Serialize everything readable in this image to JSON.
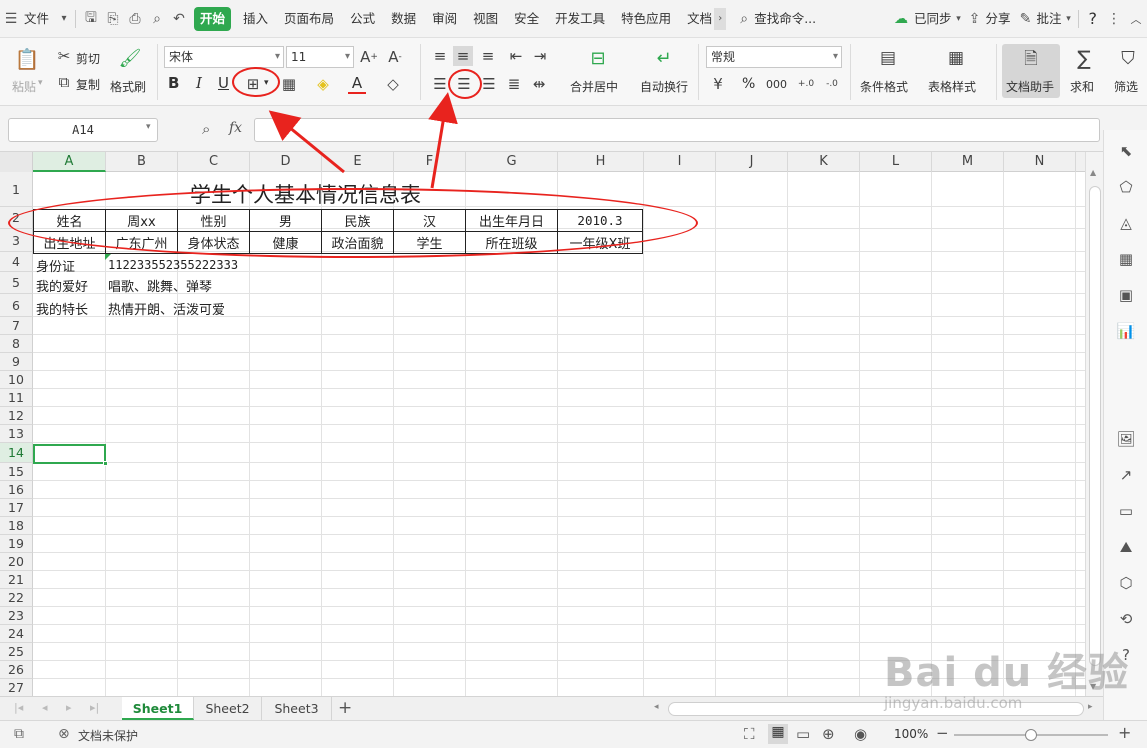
{
  "menubar": {
    "file_label": "文件",
    "tabs": [
      "开始",
      "插入",
      "页面布局",
      "公式",
      "数据",
      "审阅",
      "视图",
      "安全",
      "开发工具",
      "特色应用",
      "文档"
    ],
    "active_tab": "开始",
    "search_label": "查找命令...",
    "sync_label": "已同步",
    "share_label": "分享",
    "comment_label": "批注",
    "help_label": "?"
  },
  "ribbon": {
    "paste_label": "粘贴",
    "cut_label": "剪切",
    "copy_label": "复制",
    "format_painter_label": "格式刷",
    "font_name": "宋体",
    "font_size": "11",
    "bold_label": "B",
    "italic_label": "I",
    "underline_label": "U",
    "merge_center_label": "合并居中",
    "wrap_text_label": "自动换行",
    "number_format": "常规",
    "percent_label": "%",
    "thousands_label": "000",
    "cond_format_label": "条件格式",
    "table_style_label": "表格样式",
    "doc_assistant_label": "文档助手",
    "sum_label": "求和",
    "filter_label": "筛选"
  },
  "formula_bar": {
    "name_box": "A14",
    "fx_label": "fx",
    "value": ""
  },
  "grid": {
    "columns": [
      "A",
      "B",
      "C",
      "D",
      "E",
      "F",
      "G",
      "H",
      "I",
      "J",
      "K",
      "L",
      "M",
      "N"
    ],
    "rows": [
      "1",
      "2",
      "3",
      "4",
      "5",
      "6",
      "7",
      "8",
      "9",
      "10",
      "11",
      "12",
      "13",
      "14",
      "15",
      "16",
      "17",
      "18",
      "19",
      "20",
      "21",
      "22",
      "23",
      "24",
      "25",
      "26",
      "27"
    ],
    "selected_column": "A",
    "selected_row": "14",
    "title": "学生个人基本情况信息表",
    "row2": [
      "姓名",
      "周xx",
      "性别",
      "男",
      "民族",
      "汉",
      "出生年月日",
      "2010.3"
    ],
    "row3": [
      "出生地址",
      "广东广州",
      "身体状态",
      "健康",
      "政治面貌",
      "学生",
      "所在班级",
      "一年级X班"
    ],
    "row4": [
      "身份证",
      "112233552355222333"
    ],
    "row5": [
      "我的爱好",
      "唱歌、跳舞、弹琴"
    ],
    "row6": [
      "我的特长",
      "热情开朗、活泼可爱"
    ]
  },
  "sheets": {
    "tabs": [
      "Sheet1",
      "Sheet2",
      "Sheet3"
    ],
    "active": "Sheet1",
    "add_label": "+"
  },
  "status": {
    "protect_label": "文档未保护",
    "zoom": "100%",
    "zoom_fraction": 0.5
  },
  "watermark": {
    "logo": "Bai du 经验",
    "url": "jingyan.baidu.com"
  },
  "colors": {
    "accent": "#2fa84f",
    "annotation": "#e8231e"
  }
}
